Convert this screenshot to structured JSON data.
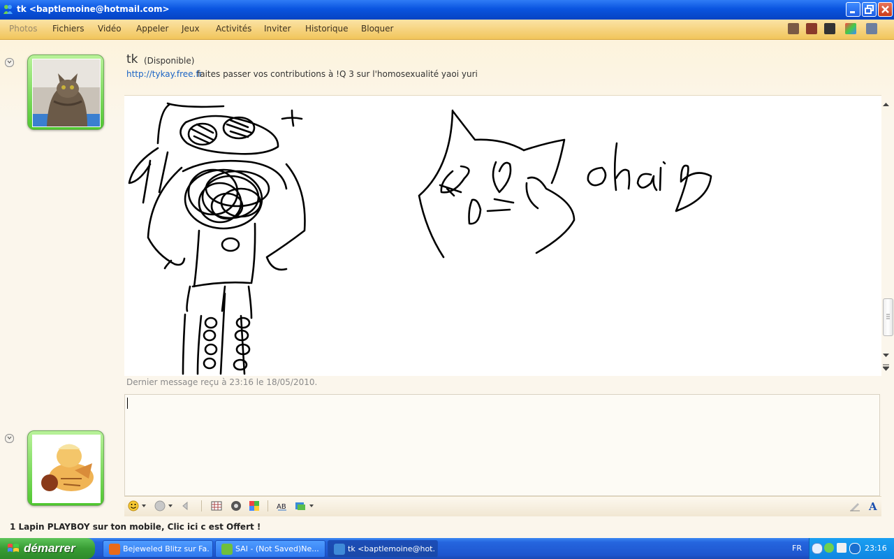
{
  "window": {
    "title": "tk <baptlemoine@hotmail.com>"
  },
  "menu": {
    "items": [
      "Photos",
      "Fichiers",
      "Vidéo",
      "Appeler",
      "Jeux",
      "Activités",
      "Inviter",
      "Historique",
      "Bloquer"
    ]
  },
  "contact": {
    "name": "tk",
    "status": "(Disponible)",
    "link": "http://tykay.free.fr",
    "message": "faites passer vos contributions à !Q 3 sur l'homosexualité yaoi yuri"
  },
  "conversation": {
    "handwriting": "ohai",
    "last_message": "Dernier message reçu à 23:16 le 18/05/2010."
  },
  "ad": {
    "text": "1 Lapin PLAYBOY sur ton mobile, Clic ici c est Offert !"
  },
  "taskbar": {
    "start_label": "démarrer",
    "tasks": [
      {
        "label": "Bejeweled Blitz sur Fa...",
        "color": "#e86a1a"
      },
      {
        "label": "SAI - (Not Saved)Ne...",
        "color": "#6fbf3c"
      },
      {
        "label": "tk <baptlemoine@hot...",
        "color": "#3f8ad8"
      }
    ],
    "language": "FR",
    "clock": "23:16"
  }
}
